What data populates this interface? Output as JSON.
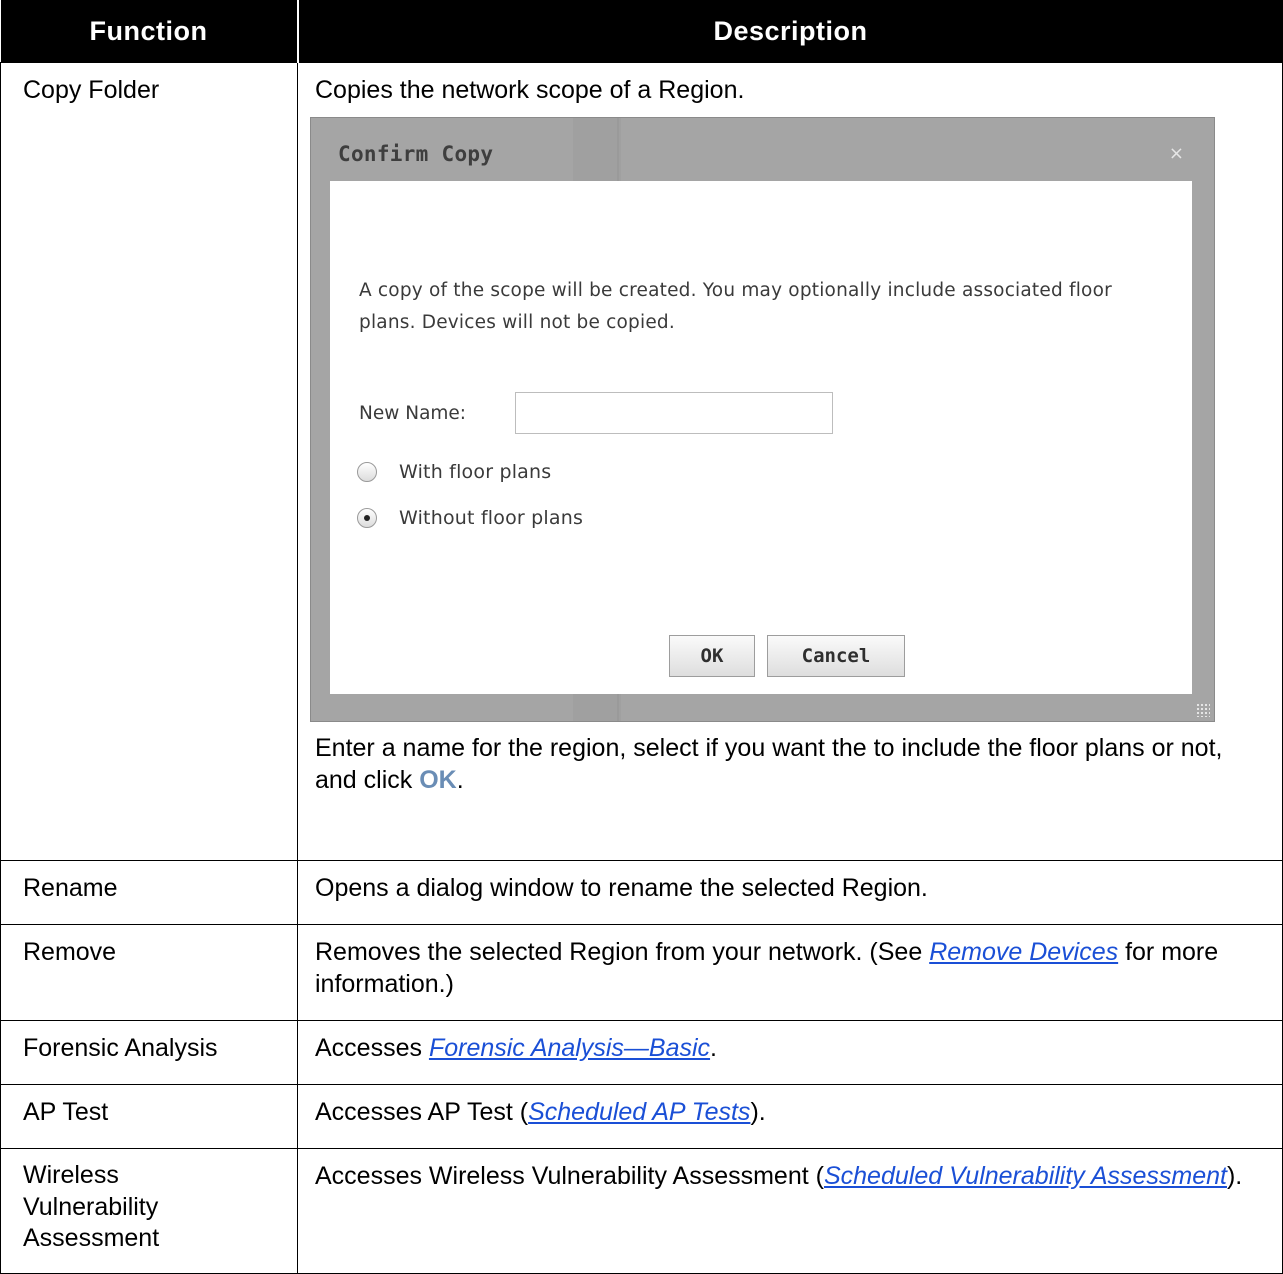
{
  "table": {
    "headers": {
      "function": "Function",
      "description": "Description"
    },
    "copy_folder": {
      "function": "Copy Folder",
      "description": "Copies the network scope of a Region.",
      "after_text": "Enter a name for the region, select if you want the to include the floor plans or not, and click ",
      "ok_ref": "OK",
      "after_end": "."
    },
    "rename": {
      "function": "Rename",
      "description": "Opens a dialog window to rename the selected Region."
    },
    "remove": {
      "function": "Remove",
      "desc_before": "Removes the selected Region from your network. (See ",
      "link": "Remove Devices",
      "desc_after": " for more information.)"
    },
    "forensic": {
      "function": "Forensic Analysis",
      "desc_before": "Accesses ",
      "link": "Forensic Analysis—Basic",
      "desc_after": "."
    },
    "ap_test": {
      "function": "AP Test",
      "desc_before": "Accesses AP Test (",
      "link": "Scheduled AP Tests",
      "desc_after": ")."
    },
    "wva": {
      "function_lines": [
        "Wireless",
        "Vulnerability",
        "Assessment"
      ],
      "desc_before": "Accesses Wireless Vulnerability Assessment (",
      "link": "Scheduled Vulnerability Assessment",
      "desc_after": ")."
    }
  },
  "dialog": {
    "title": "Confirm Copy",
    "close_glyph": "×",
    "message": "A copy of the scope will be created. You may optionally include associated floor plans. Devices will not be copied.",
    "name_label": "New Name:",
    "name_value": "",
    "radio_with": "With floor plans",
    "radio_without": "Without floor plans",
    "selected_option": "Without floor plans",
    "ok_label": "OK",
    "cancel_label": "Cancel"
  },
  "colors": {
    "header_bg": "#000000",
    "link": "#1a4fd6",
    "ok_ref": "#6a8db5"
  }
}
